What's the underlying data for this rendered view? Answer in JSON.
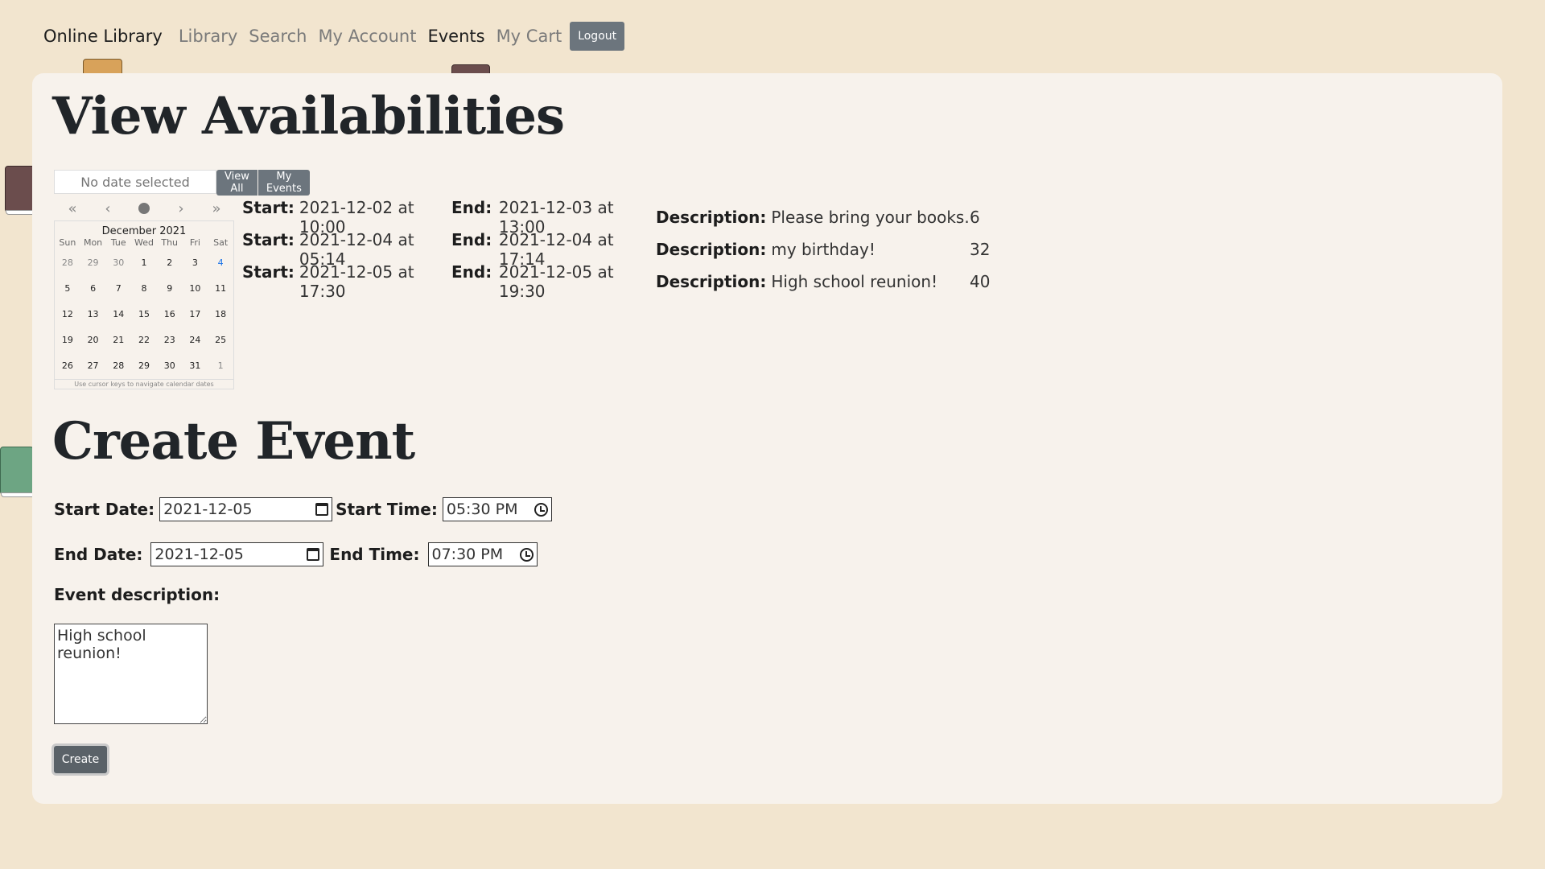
{
  "nav": {
    "brand": "Online Library",
    "links": [
      "Library",
      "Search",
      "My Account",
      "Events",
      "My Cart"
    ],
    "active": "Events",
    "logout": "Logout"
  },
  "view": {
    "title": "View Availabilities",
    "date_placeholder": "No date selected",
    "view_all": "View All",
    "my_events": "My Events"
  },
  "calendar": {
    "month": "December 2021",
    "weekdays": [
      "Sun",
      "Mon",
      "Tue",
      "Wed",
      "Thu",
      "Fri",
      "Sat"
    ],
    "weeks": [
      [
        "28",
        "29",
        "30",
        "1",
        "2",
        "3",
        "4"
      ],
      [
        "5",
        "6",
        "7",
        "8",
        "9",
        "10",
        "11"
      ],
      [
        "12",
        "13",
        "14",
        "15",
        "16",
        "17",
        "18"
      ],
      [
        "19",
        "20",
        "21",
        "22",
        "23",
        "24",
        "25"
      ],
      [
        "26",
        "27",
        "28",
        "29",
        "30",
        "31",
        "1"
      ]
    ],
    "hint": "Use cursor keys to navigate calendar dates",
    "nav_icons": [
      "double-chevron-left-icon",
      "chevron-left-icon",
      "dot-icon",
      "chevron-right-icon",
      "double-chevron-right-icon"
    ]
  },
  "events": {
    "start_label": "Start:",
    "end_label": "End:",
    "desc_label": "Description:",
    "rows": [
      {
        "start": "2021-12-02 at 10:00",
        "end": "2021-12-03 at 13:00",
        "description": "Please bring your books.",
        "count": "6"
      },
      {
        "start": "2021-12-04 at 05:14",
        "end": "2021-12-04 at 17:14",
        "description": "my birthday!",
        "count": "32"
      },
      {
        "start": "2021-12-05 at 17:30",
        "end": "2021-12-05 at 19:30",
        "description": "High school reunion!",
        "count": "40"
      }
    ]
  },
  "create": {
    "title": "Create Event",
    "start_date_label": "Start Date:",
    "start_date": "2021-12-05",
    "start_time_label": "Start Time:",
    "start_time": "05:30 PM",
    "end_date_label": "End Date:",
    "end_date": "2021-12-05",
    "end_time_label": "End Time:",
    "end_time": "07:30 PM",
    "description_label": "Event description:",
    "description": "High school reunion!",
    "submit": "Create"
  },
  "colors": {
    "background": "#f2e5cf",
    "panel": "#f7f2ec",
    "button": "#6c757d"
  }
}
